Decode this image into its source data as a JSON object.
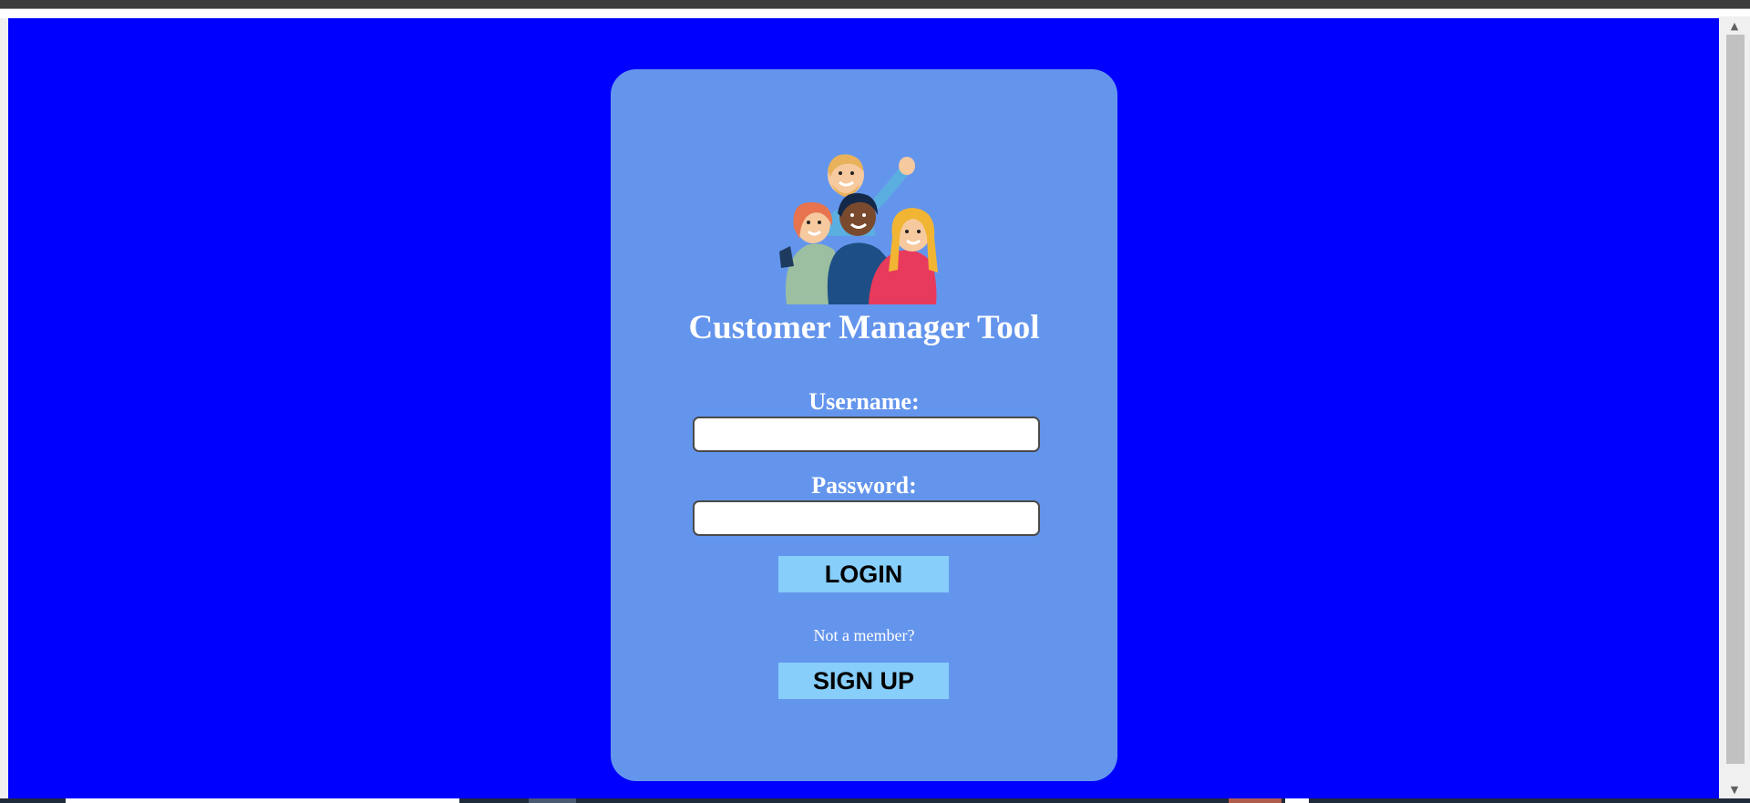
{
  "login_card": {
    "title": "Customer Manager Tool",
    "username_label": "Username:",
    "username_value": "",
    "password_label": "Password:",
    "password_value": "",
    "login_button": "LOGIN",
    "member_prompt": "Not a member?",
    "signup_button": "SIGN UP"
  },
  "colors": {
    "page_background": "#0000ff",
    "card_background": "#6495ed",
    "button_background": "#87cefa",
    "text": "#ffffff"
  },
  "icons": {
    "illustration": "group-of-people-illustration",
    "scroll_up": "chevron-up-icon",
    "scroll_down": "chevron-down-icon"
  }
}
